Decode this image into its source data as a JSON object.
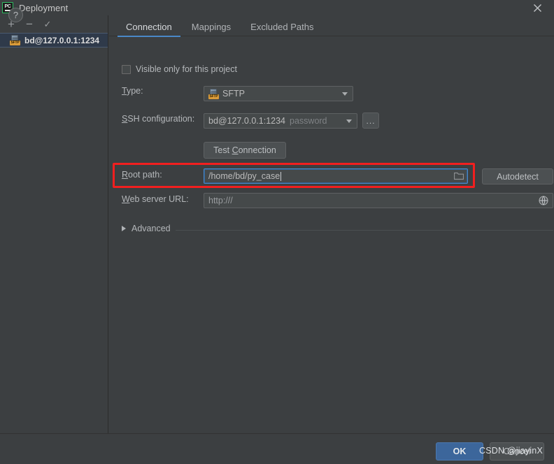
{
  "window": {
    "title": "Deployment",
    "app_icon": "pycharm-logo-icon",
    "close_icon": "close-icon"
  },
  "sidebar": {
    "toolbar": [
      {
        "name": "add-server-button",
        "glyph": "+"
      },
      {
        "name": "remove-server-button",
        "glyph": "−"
      },
      {
        "name": "set-default-server-button",
        "glyph": "✓"
      }
    ],
    "items": [
      {
        "label": "bd@127.0.0.1:1234",
        "icon": "sftp-server-icon",
        "icon_tag": "SFTP",
        "selected": true
      }
    ]
  },
  "tabs": [
    {
      "label": "Connection",
      "active": true
    },
    {
      "label": "Mappings",
      "active": false
    },
    {
      "label": "Excluded Paths",
      "active": false
    }
  ],
  "form": {
    "visible_only_checkbox": {
      "label": "Visible only for this project",
      "checked": false
    },
    "type": {
      "label": "Type:",
      "mnemonic": "T",
      "value": "SFTP",
      "icon": "sftp-protocol-icon",
      "icon_tag": "SFTP"
    },
    "ssh_configuration": {
      "label": "SSH configuration:",
      "mnemonic": "S",
      "value": "bd@127.0.0.1:1234",
      "auth_hint": "password",
      "browse_button": "..."
    },
    "test_connection": {
      "label": "Test Connection",
      "mnemonic": "C"
    },
    "root_path": {
      "label": "Root path:",
      "mnemonic": "R",
      "value": "/home/bd/py_case",
      "browse_icon": "folder-icon",
      "focused": true,
      "highlighted": true
    },
    "autodetect": {
      "label": "Autodetect"
    },
    "web_server_url": {
      "label": "Web server URL:",
      "mnemonic": "W",
      "value": "http:///",
      "open_icon": "globe-icon"
    },
    "advanced": {
      "label": "Advanced",
      "expanded": false,
      "chevron_icon": "chevron-right-icon"
    }
  },
  "footer": {
    "help_label": "?",
    "ok_label": "OK",
    "cancel_label": "Cancel"
  },
  "watermark": {
    "text": "CSDN @jiayinX"
  },
  "colors": {
    "background": "#3c3f41",
    "accent_tab": "#4a88c7",
    "ok_button": "#3c669b",
    "selection": "#2f3a4a",
    "highlight_box": "#f21f1f",
    "sftp_tag": "#d99b3a"
  }
}
